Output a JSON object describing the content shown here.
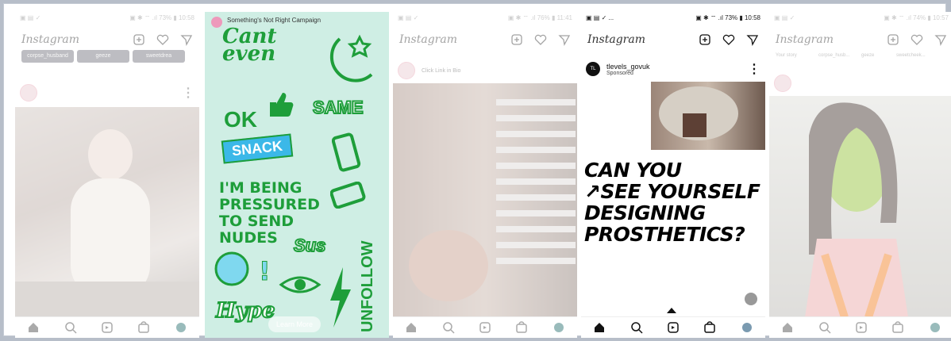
{
  "panels": {
    "p1": {
      "status": {
        "left": "▣ ▤ ✓",
        "right": "▣ ✱ ⌔ .ıl 73% ▮ 10:58"
      },
      "logo": "Instagram",
      "stories": [
        "corpse_husband",
        "geeze",
        "sweetdrea"
      ]
    },
    "p2": {
      "campaign": "Something's Not Right Campaign",
      "cant": "Cant\neven",
      "ok": "OK",
      "same": "SAME",
      "snack": "SNACK",
      "pressured": "I'M BEING\nPRESSURED\nTO SEND\nNUDES",
      "sus": "Sus",
      "unfollow": "UNFOLLOW",
      "hype": "Hype",
      "learn_more": "Learn More"
    },
    "p3": {
      "status": {
        "left": "▣ ▤ ✓",
        "right": "▣ ✱ ⌔ .ıl 76% ▮ 11:41"
      },
      "logo": "Instagram",
      "post_caption": "Click Link in Bio"
    },
    "p4": {
      "status": {
        "left": "▣ ▤ ✓ ...",
        "right": "▣ ✱ ⌔ .ıl 73% ▮ 10:58"
      },
      "logo": "Instagram",
      "handle": "tlevels_govuk",
      "sponsored": "Sponsored",
      "avatar_text": "TL",
      "headline": "CAN YOU\n↗SEE YOURSELF\nDESIGNING\nPROSTHETICS?"
    },
    "p5": {
      "status": {
        "left": "▣ ▤ ✓",
        "right": "▣ ✱ ⌔ .ıl 74% ▮ 10:57"
      },
      "logo": "Instagram",
      "stories": [
        "Your story",
        "corpse_husb...",
        "geeze",
        "sweetcheek..."
      ]
    }
  },
  "colors": {
    "sticker_green": "#1e9e3a",
    "sticker_bg": "#cfeee4",
    "snack_blue": "#3bb8e8",
    "frame_border": "#b7bec9"
  },
  "icons": [
    "plus-square-icon",
    "heart-icon",
    "send-icon",
    "home-icon",
    "search-icon",
    "reels-icon",
    "shop-icon",
    "profile-icon"
  ]
}
